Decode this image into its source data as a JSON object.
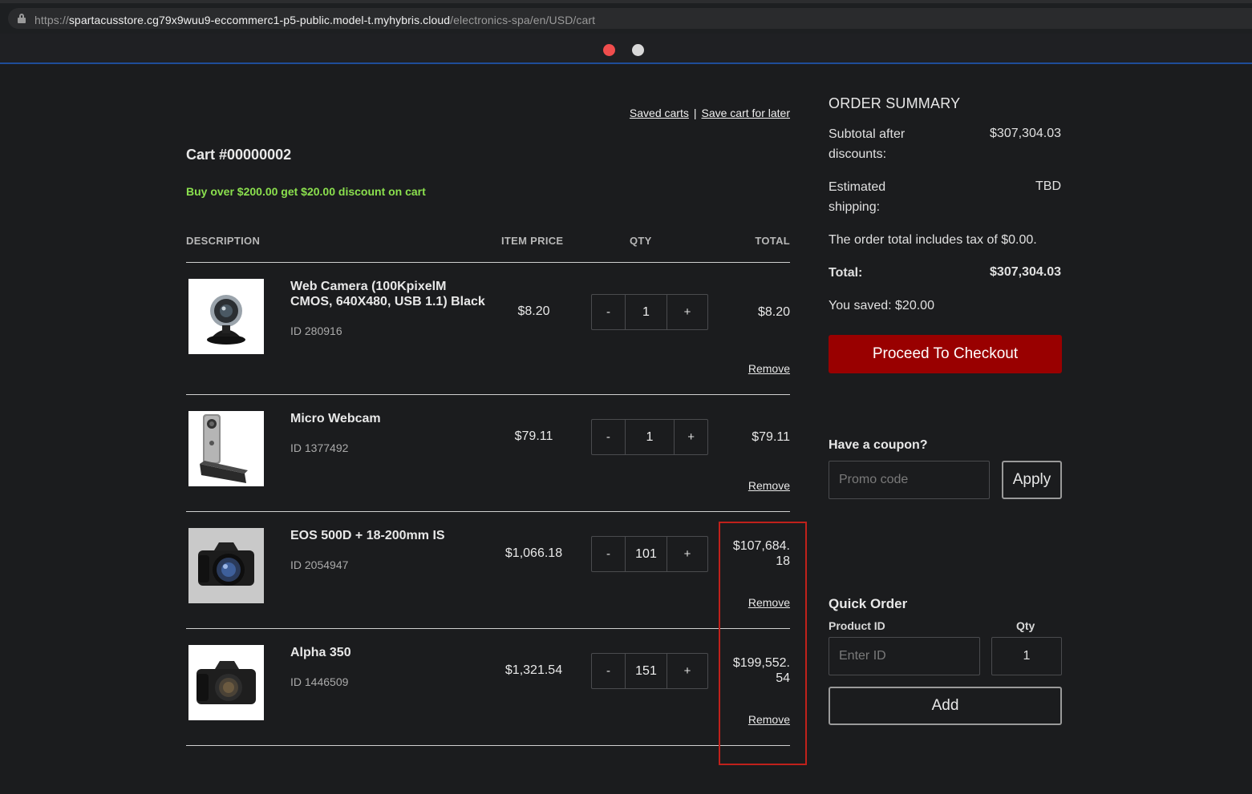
{
  "browser": {
    "url_scheme": "https://",
    "url_host": "spartacusstore.cg79x9wuu9-eccommerc1-p5-public.model-t.myhybris.cloud",
    "url_path": "/electronics-spa/en/USD/cart"
  },
  "cart": {
    "links": {
      "saved_carts": "Saved carts",
      "separator": "|",
      "save_for_later": "Save cart for later"
    },
    "title": "Cart #00000002",
    "promotion": "Buy over $200.00 get $20.00 discount on cart",
    "headers": {
      "description": "DESCRIPTION",
      "item_price": "ITEM PRICE",
      "qty": "QTY",
      "total": "TOTAL"
    },
    "qty_minus": "-",
    "qty_plus": "+",
    "remove_label": "Remove",
    "items": [
      {
        "name_line1": "Web Camera (100KpixelM",
        "name_line2": "CMOS, 640X480, USB 1.1) Black",
        "id": "ID 280916",
        "price": "$8.20",
        "qty": "1",
        "total_line1": "$8.20",
        "total_line2": "",
        "image_icon": "webcam-icon"
      },
      {
        "name_line1": "Micro Webcam",
        "name_line2": "",
        "id": "ID 1377492",
        "price": "$79.11",
        "qty": "1",
        "total_line1": "$79.11",
        "total_line2": "",
        "image_icon": "micro-webcam-icon"
      },
      {
        "name_line1": "EOS 500D + 18-200mm IS",
        "name_line2": "",
        "id": "ID 2054947",
        "price": "$1,066.18",
        "qty": "101",
        "total_line1": "$107,684.",
        "total_line2": "18",
        "image_icon": "camera-icon"
      },
      {
        "name_line1": "Alpha 350",
        "name_line2": "",
        "id": "ID 1446509",
        "price": "$1,321.54",
        "qty": "151",
        "total_line1": "$199,552.",
        "total_line2": "54",
        "image_icon": "camera-body-icon"
      }
    ]
  },
  "summary": {
    "title": "ORDER SUMMARY",
    "subtotal_label_1": "Subtotal after",
    "subtotal_label_2": "discounts:",
    "subtotal_value": "$307,304.03",
    "shipping_label_1": "Estimated",
    "shipping_label_2": "shipping:",
    "shipping_value": "TBD",
    "tax_note": "The order total includes tax of $0.00.",
    "total_label": "Total:",
    "total_value": "$307,304.03",
    "saved": "You saved: $20.00",
    "checkout_label": "Proceed To Checkout"
  },
  "coupon": {
    "heading": "Have a coupon?",
    "placeholder": "Promo code",
    "apply_label": "Apply"
  },
  "quick_order": {
    "heading": "Quick Order",
    "product_label": "Product ID",
    "qty_label": "Qty",
    "product_placeholder": "Enter ID",
    "qty_value": "1",
    "add_label": "Add"
  },
  "colors": {
    "background": "#1b1c1e",
    "promo_green": "#8be04e",
    "checkout_red": "#990000",
    "highlight_red": "#c0211b",
    "browser_accent": "#1f4d99"
  }
}
